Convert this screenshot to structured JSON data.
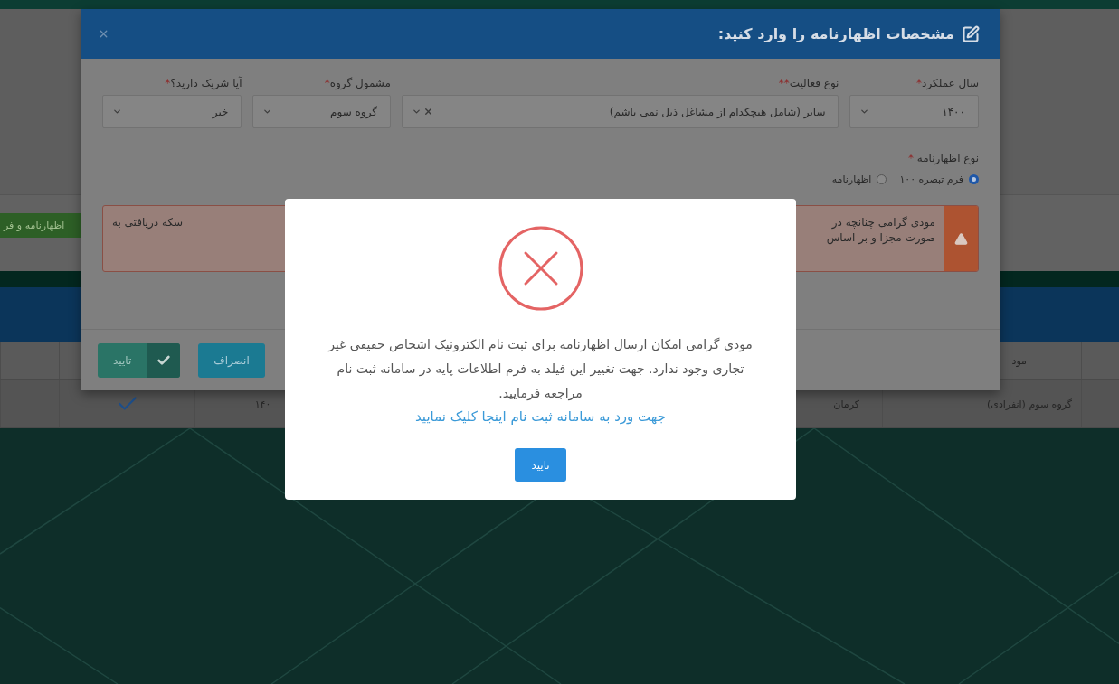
{
  "background_page": {
    "side_button": "اظهارنامه و فر",
    "table": {
      "header": [
        "مود"
      ],
      "row": {
        "confirmed": true,
        "cells": [
          "گروه سوم (انفرادی)",
          "کرمان",
          "۱۴۰"
        ]
      }
    }
  },
  "form_modal": {
    "title": "مشخصات اظهارنامه را وارد کنید:",
    "fields": [
      {
        "label": "سال عملکرد",
        "required_mark": "*",
        "value": "۱۴۰۰",
        "clearable": false
      },
      {
        "label": "نوع فعالیت",
        "required_mark": "**",
        "value": "سایر (شامل هیچکدام از مشاغل ذیل نمی باشم)",
        "clearable": true
      },
      {
        "label": "مشمول گروه",
        "required_mark": "*",
        "value": "گروه سوم",
        "clearable": false
      },
      {
        "label": "آیا شریک دارید؟",
        "required_mark": "*",
        "value": "خیر",
        "clearable": false
      }
    ],
    "return_type": {
      "label": "نوع اظهارنامه",
      "required_mark": "*",
      "options": [
        {
          "label": "فرم تبصره ۱۰۰",
          "selected": true
        },
        {
          "label": "اظهارنامه",
          "selected": false
        }
      ]
    },
    "warning": {
      "visible_start": [
        "مودی گرامی چنانچه در",
        "صورت مجزا و بر اساس"
      ],
      "visible_end": "سکه دریافتی به"
    },
    "buttons": [
      {
        "label": "انصراف",
        "kind": "cancel"
      },
      {
        "label": "تایید",
        "kind": "confirm"
      }
    ]
  },
  "alert": {
    "kind": "error",
    "message": "مودی گرامی امکان ارسال اظهارنامه برای ثبت نام الکترونیک اشخاص حقیقی غیر تجاری وجود ندارد. جهت تغییر این فیلد به فرم اطلاعات پایه در سامانه ثبت نام مراجعه فرمایید.",
    "link": "جهت ورد به سامانه ثبت نام اینجا کلیک نمایید",
    "button": "تایید"
  }
}
